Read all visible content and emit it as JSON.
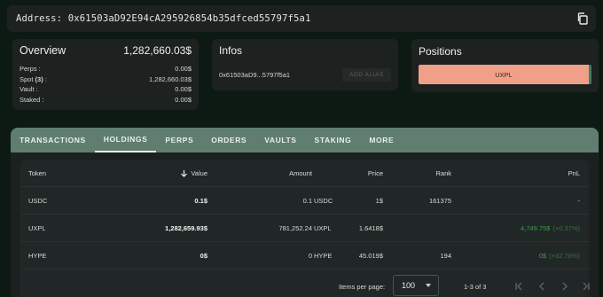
{
  "address": {
    "text": "Address: 0x61503aD92E94cA295926854b35dfced55797f5a1",
    "copy_icon": "copy-icon"
  },
  "overview": {
    "title": "Overview",
    "total": "1,282,660.03$",
    "rows": [
      {
        "label": "Perps :",
        "value": "0.00$"
      },
      {
        "label": "Spot",
        "label_count": "(3)",
        "label_suffix": " :",
        "value": "1,282,660.03$"
      },
      {
        "label": "Vault :",
        "value": "0.00$"
      },
      {
        "label": "Staked :",
        "value": "0.00$"
      }
    ]
  },
  "infos": {
    "title": "Infos",
    "short_address": "0x61503aD9...5797f5a1",
    "alias_button": "ADD ALIAS"
  },
  "positions": {
    "title": "Positions",
    "bar_label": "UXPL",
    "bar_share": 1.0,
    "bar_color": "#f0a088"
  },
  "tabs": [
    "TRANSACTIONS",
    "HOLDINGS",
    "PERPS",
    "ORDERS",
    "VAULTS",
    "STAKING",
    "MORE"
  ],
  "active_tab": "HOLDINGS",
  "table": {
    "headers": {
      "token": "Token",
      "value": "Value",
      "amount": "Amount",
      "price": "Price",
      "rank": "Rank",
      "pnl": "PnL"
    },
    "sort_icon": "arrow-down-icon",
    "rows": [
      {
        "token": "USDC",
        "value": "0.1$",
        "amount": "0.1",
        "unit": "USDC",
        "price": "1$",
        "rank": "161375",
        "pnl": "-",
        "pnl_pct": ""
      },
      {
        "token": "UXPL",
        "value": "1,282,659.93$",
        "amount": "781,252.24",
        "unit": "UXPL",
        "price": "1.6418$",
        "rank": "",
        "pnl": "4,749.75$",
        "pnl_pct": "(+0.37%)"
      },
      {
        "token": "HYPE",
        "value": "0$",
        "amount": "0",
        "unit": "HYPE",
        "price": "45.019$",
        "rank": "194",
        "pnl": "0$",
        "pnl_pct": "(+32.76%)"
      }
    ]
  },
  "pagination": {
    "items_per_page_label": "Items per page:",
    "items_per_page": "100",
    "range": "1-3 of 3"
  },
  "colors": {
    "background": "#0d1a14",
    "card": "#1d2221",
    "tabs_bar": "#5f7e6f",
    "pnl_positive": "#3e9b4f"
  }
}
